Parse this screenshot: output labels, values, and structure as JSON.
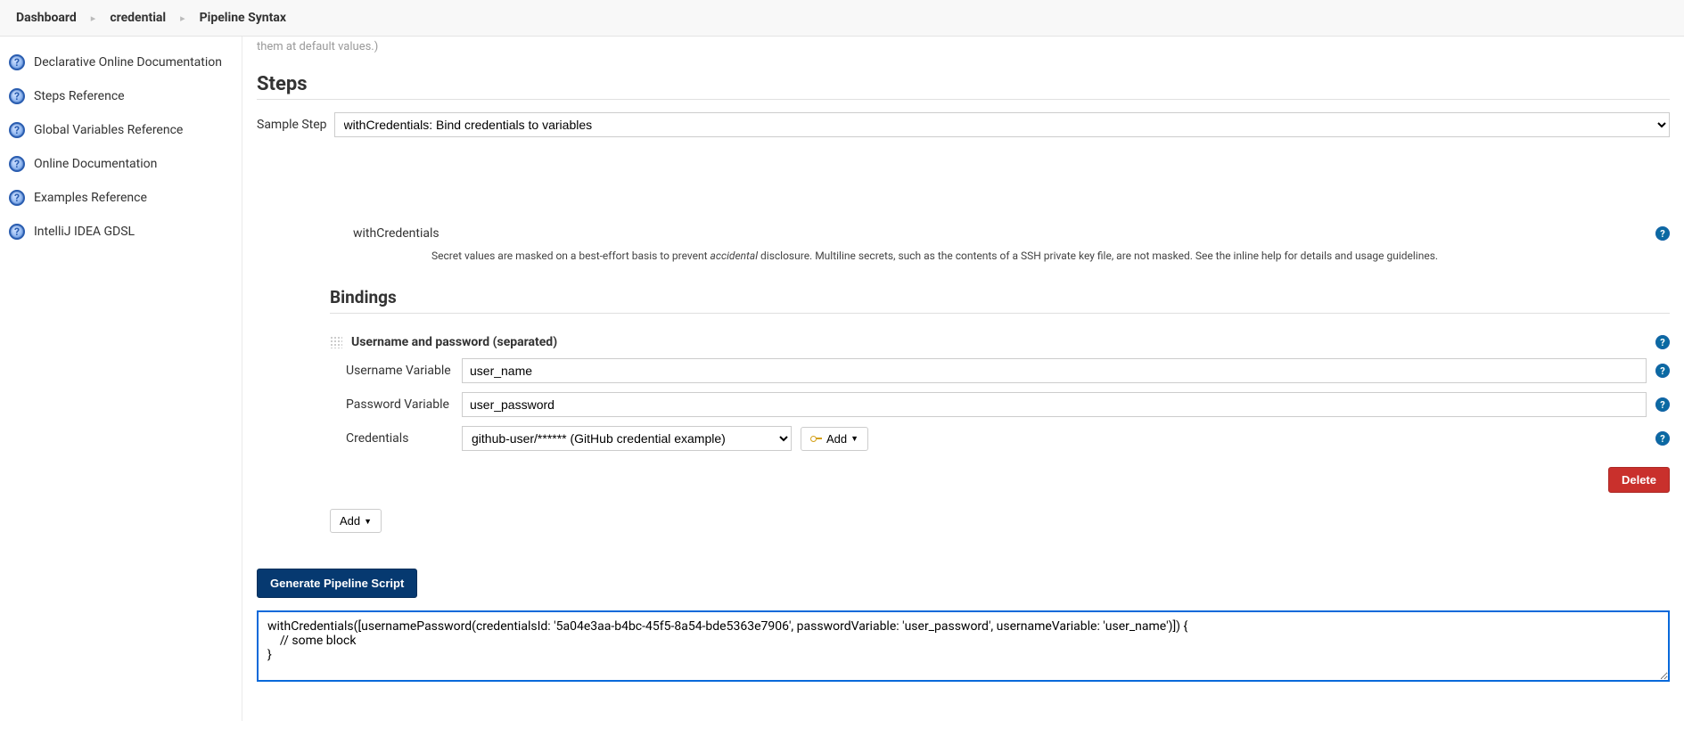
{
  "breadcrumb": [
    {
      "label": "Dashboard"
    },
    {
      "label": "credential"
    },
    {
      "label": "Pipeline Syntax"
    }
  ],
  "sidebar": {
    "items": [
      {
        "label": "Declarative Online Documentation"
      },
      {
        "label": "Steps Reference"
      },
      {
        "label": "Global Variables Reference"
      },
      {
        "label": "Online Documentation"
      },
      {
        "label": "Examples Reference"
      },
      {
        "label": "IntelliJ IDEA GDSL"
      }
    ]
  },
  "main": {
    "truncated_hint": "them at default values.)",
    "steps_heading": "Steps",
    "sample_step_label": "Sample Step",
    "sample_step_value": "withCredentials: Bind credentials to variables",
    "step_name": "withCredentials",
    "step_note_pre": "Secret values are masked on a best-effort basis to prevent ",
    "step_note_em": "accidental",
    "step_note_post": " disclosure. Multiline secrets, such as the contents of a SSH private key file, are not masked. See the inline help for details and usage guidelines.",
    "bindings_heading": "Bindings",
    "binding": {
      "title": "Username and password (separated)",
      "username_var_label": "Username Variable",
      "username_var_value": "user_name",
      "password_var_label": "Password Variable",
      "password_var_value": "user_password",
      "credentials_label": "Credentials",
      "credentials_value": "github-user/****** (GitHub credential example)",
      "add_cred_label": "Add"
    },
    "delete_label": "Delete",
    "add_binding_label": "Add",
    "generate_label": "Generate Pipeline Script",
    "output": "withCredentials([usernamePassword(credentialsId: '5a04e3aa-b4bc-45f5-8a54-bde5363e7906', passwordVariable: 'user_password', usernameVariable: 'user_name')]) {\n    // some block\n}"
  }
}
